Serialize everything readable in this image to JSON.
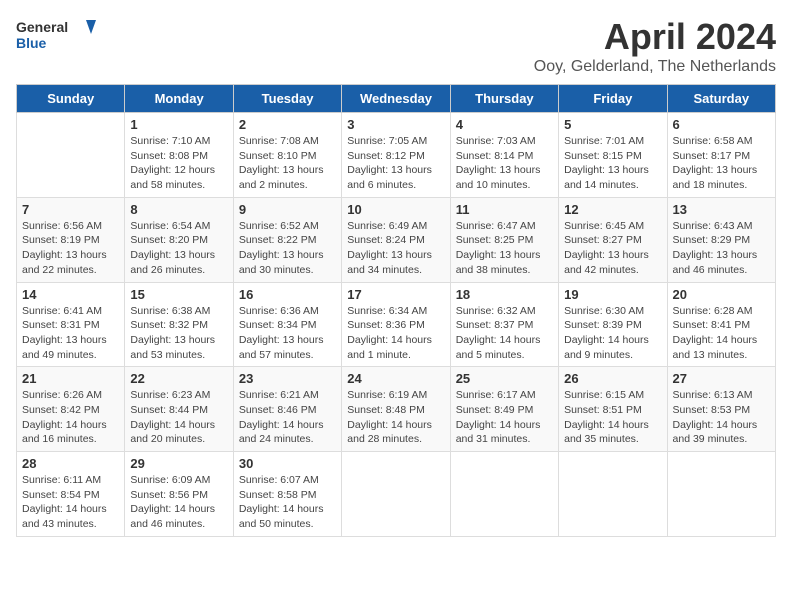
{
  "logo": {
    "text_general": "General",
    "text_blue": "Blue"
  },
  "title": "April 2024",
  "subtitle": "Ooy, Gelderland, The Netherlands",
  "days_header": [
    "Sunday",
    "Monday",
    "Tuesday",
    "Wednesday",
    "Thursday",
    "Friday",
    "Saturday"
  ],
  "weeks": [
    [
      {
        "day": "",
        "info": ""
      },
      {
        "day": "1",
        "info": "Sunrise: 7:10 AM\nSunset: 8:08 PM\nDaylight: 12 hours\nand 58 minutes."
      },
      {
        "day": "2",
        "info": "Sunrise: 7:08 AM\nSunset: 8:10 PM\nDaylight: 13 hours\nand 2 minutes."
      },
      {
        "day": "3",
        "info": "Sunrise: 7:05 AM\nSunset: 8:12 PM\nDaylight: 13 hours\nand 6 minutes."
      },
      {
        "day": "4",
        "info": "Sunrise: 7:03 AM\nSunset: 8:14 PM\nDaylight: 13 hours\nand 10 minutes."
      },
      {
        "day": "5",
        "info": "Sunrise: 7:01 AM\nSunset: 8:15 PM\nDaylight: 13 hours\nand 14 minutes."
      },
      {
        "day": "6",
        "info": "Sunrise: 6:58 AM\nSunset: 8:17 PM\nDaylight: 13 hours\nand 18 minutes."
      }
    ],
    [
      {
        "day": "7",
        "info": "Sunrise: 6:56 AM\nSunset: 8:19 PM\nDaylight: 13 hours\nand 22 minutes."
      },
      {
        "day": "8",
        "info": "Sunrise: 6:54 AM\nSunset: 8:20 PM\nDaylight: 13 hours\nand 26 minutes."
      },
      {
        "day": "9",
        "info": "Sunrise: 6:52 AM\nSunset: 8:22 PM\nDaylight: 13 hours\nand 30 minutes."
      },
      {
        "day": "10",
        "info": "Sunrise: 6:49 AM\nSunset: 8:24 PM\nDaylight: 13 hours\nand 34 minutes."
      },
      {
        "day": "11",
        "info": "Sunrise: 6:47 AM\nSunset: 8:25 PM\nDaylight: 13 hours\nand 38 minutes."
      },
      {
        "day": "12",
        "info": "Sunrise: 6:45 AM\nSunset: 8:27 PM\nDaylight: 13 hours\nand 42 minutes."
      },
      {
        "day": "13",
        "info": "Sunrise: 6:43 AM\nSunset: 8:29 PM\nDaylight: 13 hours\nand 46 minutes."
      }
    ],
    [
      {
        "day": "14",
        "info": "Sunrise: 6:41 AM\nSunset: 8:31 PM\nDaylight: 13 hours\nand 49 minutes."
      },
      {
        "day": "15",
        "info": "Sunrise: 6:38 AM\nSunset: 8:32 PM\nDaylight: 13 hours\nand 53 minutes."
      },
      {
        "day": "16",
        "info": "Sunrise: 6:36 AM\nSunset: 8:34 PM\nDaylight: 13 hours\nand 57 minutes."
      },
      {
        "day": "17",
        "info": "Sunrise: 6:34 AM\nSunset: 8:36 PM\nDaylight: 14 hours\nand 1 minute."
      },
      {
        "day": "18",
        "info": "Sunrise: 6:32 AM\nSunset: 8:37 PM\nDaylight: 14 hours\nand 5 minutes."
      },
      {
        "day": "19",
        "info": "Sunrise: 6:30 AM\nSunset: 8:39 PM\nDaylight: 14 hours\nand 9 minutes."
      },
      {
        "day": "20",
        "info": "Sunrise: 6:28 AM\nSunset: 8:41 PM\nDaylight: 14 hours\nand 13 minutes."
      }
    ],
    [
      {
        "day": "21",
        "info": "Sunrise: 6:26 AM\nSunset: 8:42 PM\nDaylight: 14 hours\nand 16 minutes."
      },
      {
        "day": "22",
        "info": "Sunrise: 6:23 AM\nSunset: 8:44 PM\nDaylight: 14 hours\nand 20 minutes."
      },
      {
        "day": "23",
        "info": "Sunrise: 6:21 AM\nSunset: 8:46 PM\nDaylight: 14 hours\nand 24 minutes."
      },
      {
        "day": "24",
        "info": "Sunrise: 6:19 AM\nSunset: 8:48 PM\nDaylight: 14 hours\nand 28 minutes."
      },
      {
        "day": "25",
        "info": "Sunrise: 6:17 AM\nSunset: 8:49 PM\nDaylight: 14 hours\nand 31 minutes."
      },
      {
        "day": "26",
        "info": "Sunrise: 6:15 AM\nSunset: 8:51 PM\nDaylight: 14 hours\nand 35 minutes."
      },
      {
        "day": "27",
        "info": "Sunrise: 6:13 AM\nSunset: 8:53 PM\nDaylight: 14 hours\nand 39 minutes."
      }
    ],
    [
      {
        "day": "28",
        "info": "Sunrise: 6:11 AM\nSunset: 8:54 PM\nDaylight: 14 hours\nand 43 minutes."
      },
      {
        "day": "29",
        "info": "Sunrise: 6:09 AM\nSunset: 8:56 PM\nDaylight: 14 hours\nand 46 minutes."
      },
      {
        "day": "30",
        "info": "Sunrise: 6:07 AM\nSunset: 8:58 PM\nDaylight: 14 hours\nand 50 minutes."
      },
      {
        "day": "",
        "info": ""
      },
      {
        "day": "",
        "info": ""
      },
      {
        "day": "",
        "info": ""
      },
      {
        "day": "",
        "info": ""
      }
    ]
  ]
}
